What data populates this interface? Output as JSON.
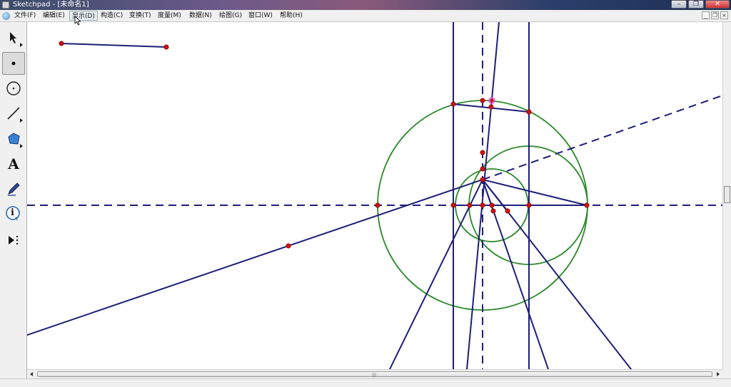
{
  "window": {
    "title": "Sketchpad - [未命名1]"
  },
  "menu": [
    {
      "label": "文件(F)",
      "id": "file"
    },
    {
      "label": "编辑(E)",
      "id": "edit"
    },
    {
      "label": "显示(D)",
      "id": "display"
    },
    {
      "label": "构造(C)",
      "id": "construct"
    },
    {
      "label": "变换(T)",
      "id": "transform"
    },
    {
      "label": "度量(M)",
      "id": "measure"
    },
    {
      "label": "数据(N)",
      "id": "data"
    },
    {
      "label": "绘图(G)",
      "id": "graph"
    },
    {
      "label": "窗口(W)",
      "id": "window"
    },
    {
      "label": "帮助(H)",
      "id": "help"
    }
  ],
  "active_menu": "display",
  "window_buttons": [
    "minimize",
    "restore",
    "close"
  ],
  "document_buttons": [
    "minimize",
    "restore",
    "close"
  ],
  "tools": [
    {
      "name": "arrow-select-tool",
      "icon": "arrow-icon",
      "has_more": true
    },
    {
      "name": "point-tool",
      "icon": "point-icon",
      "selected": true
    },
    {
      "name": "compass-tool",
      "icon": "circle-icon"
    },
    {
      "name": "straightedge-tool",
      "icon": "line-segment-icon",
      "has_more": true
    },
    {
      "name": "polygon-tool",
      "icon": "polygon-icon",
      "has_more": true
    },
    {
      "name": "text-tool",
      "icon": "text-a-icon",
      "glyph": "A"
    },
    {
      "name": "marker-tool",
      "icon": "pen-icon"
    },
    {
      "name": "information-tool",
      "icon": "info-icon",
      "glyph": "i"
    },
    {
      "name": "custom-tools",
      "icon": "play-more-icon"
    }
  ],
  "colors": {
    "line": "#1e1e78",
    "circle": "#2a8a2a",
    "point": "#cc1111",
    "point_highlight": "#d94fd9"
  }
}
